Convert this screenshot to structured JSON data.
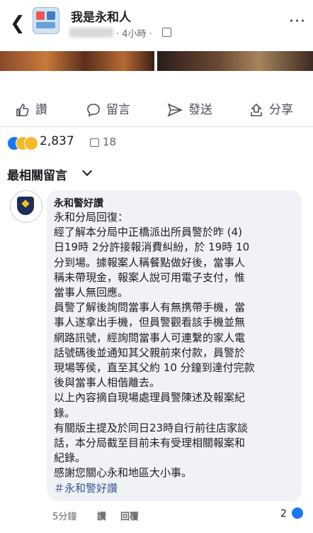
{
  "header": {
    "back_icon": "back-arrow-icon",
    "page_name": "我是永和人",
    "time": "· 4小時 ·",
    "privacy_icon": "public-icon",
    "more_label": "···"
  },
  "actions": {
    "like_label": "讚",
    "comment_label": "留言",
    "send_label": "發送",
    "share_label": "分享"
  },
  "reactions": {
    "count": "2,837",
    "shares": "18",
    "colors": {
      "like": "#1877f2",
      "emoji": "#f7b928"
    }
  },
  "comments_section": {
    "title": "最相關留言"
  },
  "comment": {
    "author": "永和警好讚",
    "lines": [
      "永和分局回復：",
      "經了解本分局中正橋派出所員警於昨 (4)",
      "日19時 2分許接報消費糾紛，於 19時 10",
      "分到場。據報案人稱餐點做好後，當事人",
      "稱未帶現金，報案人說可用電子支付，惟",
      "當事人無回應。",
      "員警了解後詢問當事人有無携帶手機，當",
      "事人遂拿出手機，但員警觀看該手機並無",
      "網路訊號，經詢問當事人可連繫的家人電",
      "話號碼後並通知其父親前來付款，員警於",
      "現場等侯，直至其父約 10 分鐘到達付完款",
      "後與當事人相偕離去。",
      "以上內容摘自現場處理員警陳述及報案紀",
      "錄。",
      "有關版主提及於同日23時自行前往店家談",
      "話，本分局截至目前未有受理相關報案和",
      "紀錄。",
      "感謝您關心永和地區大小事。"
    ],
    "hashtag": "＃永和警好讚",
    "time": "5分鐘",
    "like_label": "讚",
    "reply_label": "回覆",
    "reaction_count": "2"
  }
}
